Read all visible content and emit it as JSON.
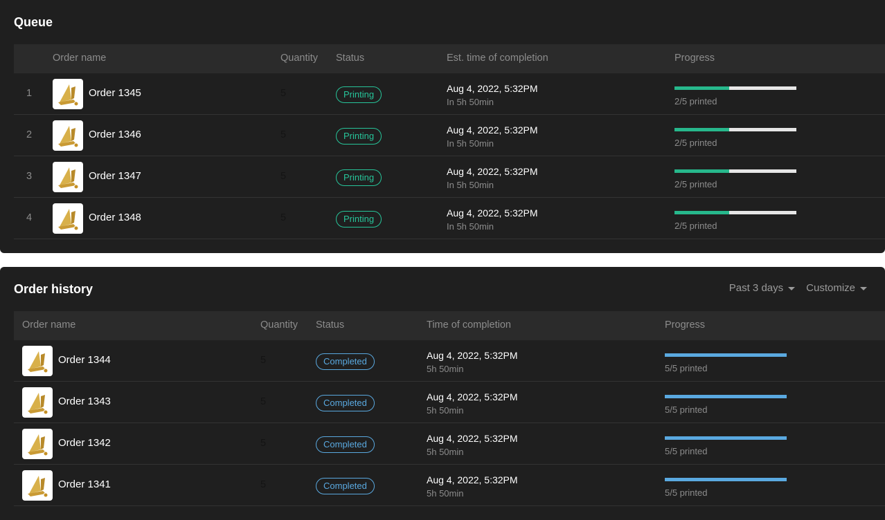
{
  "queue": {
    "title": "Queue",
    "headers": {
      "name": "Order name",
      "quantity": "Quantity",
      "status": "Status",
      "time": "Est. time of completion",
      "progress": "Progress"
    },
    "rows": [
      {
        "index": "1",
        "name": "Order 1345",
        "quantity": "5",
        "status": "Printing",
        "time": "Aug 4, 2022, 5:32PM",
        "eta": "In 5h 50min",
        "progress_label": "2/5 printed",
        "progress": 0.45
      },
      {
        "index": "2",
        "name": "Order 1346",
        "quantity": "5",
        "status": "Printing",
        "time": "Aug 4, 2022, 5:32PM",
        "eta": "In 5h 50min",
        "progress_label": "2/5 printed",
        "progress": 0.45
      },
      {
        "index": "3",
        "name": "Order 1347",
        "quantity": "5",
        "status": "Printing",
        "time": "Aug 4, 2022, 5:32PM",
        "eta": "In 5h 50min",
        "progress_label": "2/5 printed",
        "progress": 0.45
      },
      {
        "index": "4",
        "name": "Order 1348",
        "quantity": "5",
        "status": "Printing",
        "time": "Aug 4, 2022, 5:32PM",
        "eta": "In 5h 50min",
        "progress_label": "2/5 printed",
        "progress": 0.45
      }
    ]
  },
  "history": {
    "title": "Order history",
    "filters": {
      "range": "Past 3 days",
      "customize": "Customize"
    },
    "headers": {
      "name": "Order name",
      "quantity": "Quantity",
      "status": "Status",
      "time": "Time of completion",
      "progress": "Progress"
    },
    "rows": [
      {
        "name": "Order 1344",
        "quantity": "5",
        "status": "Completed",
        "time": "Aug 4, 2022, 5:32PM",
        "duration": "5h 50min",
        "progress_label": "5/5 printed",
        "progress": 1.0
      },
      {
        "name": "Order 1343",
        "quantity": "5",
        "status": "Completed",
        "time": "Aug 4, 2022, 5:32PM",
        "duration": "5h 50min",
        "progress_label": "5/5 printed",
        "progress": 1.0
      },
      {
        "name": "Order 1342",
        "quantity": "5",
        "status": "Completed",
        "time": "Aug 4, 2022, 5:32PM",
        "duration": "5h 50min",
        "progress_label": "5/5 printed",
        "progress": 1.0
      },
      {
        "name": "Order 1341",
        "quantity": "5",
        "status": "Completed",
        "time": "Aug 4, 2022, 5:32PM",
        "duration": "5h 50min",
        "progress_label": "5/5 printed",
        "progress": 1.0
      }
    ]
  },
  "colors": {
    "panel_bg": "#1f1f1f",
    "header_bg": "#2b2b2b",
    "printing": "#27c59a",
    "completed": "#5aa9e0",
    "thumbnail_art": "#d4a83c"
  },
  "icons": {
    "thumbnail": "order-thumbnail-icon",
    "caret": "chevron-down-icon"
  }
}
